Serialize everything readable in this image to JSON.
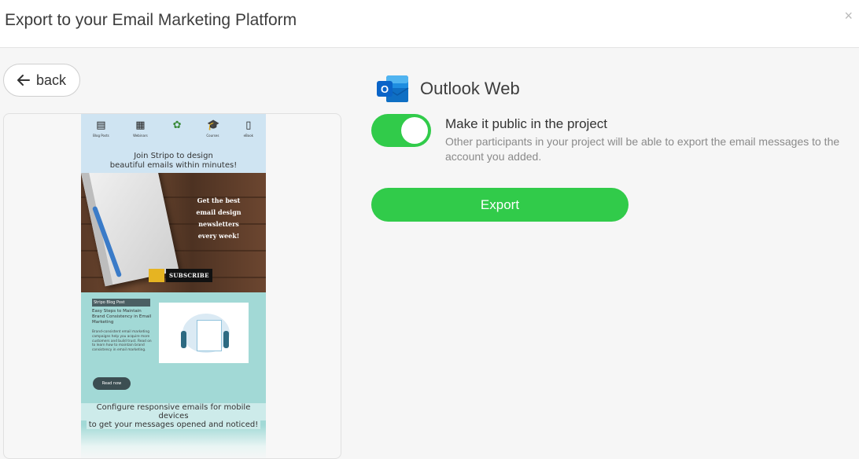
{
  "dialog": {
    "title": "Export to your Email Marketing Platform",
    "close_icon": "×"
  },
  "back_button": {
    "icon": "arrow-left-icon",
    "label": "back"
  },
  "preview": {
    "nav": [
      {
        "icon": "document-icon",
        "glyph": "▤",
        "label": "Blog Posts"
      },
      {
        "icon": "globe-icon",
        "glyph": "▦",
        "label": "Webinars"
      },
      {
        "icon": "plant-icon",
        "glyph": "✿",
        "label": ""
      },
      {
        "icon": "graduation-cap-icon",
        "glyph": "🎓",
        "label": "Courses"
      },
      {
        "icon": "book-icon",
        "glyph": "▯",
        "label": "eBook"
      }
    ],
    "join_line1": "Join Stripo to design",
    "join_line2": "beautiful emails within minutes!",
    "hero_text": [
      "Get the best",
      "email design",
      "newsletters",
      "every week!"
    ],
    "subscribe_label": "SUBSCRIBE",
    "blog_tag": "Stripo Blog Post",
    "blog_title": "Easy Steps to Maintain Brand Consistency in Email Marketing",
    "blog_body": "Brand-consistent email marketing campaigns help you acquire more customers and build trust. Read on to learn how to maintain brand consistency in email marketing.",
    "read_now": "Read now",
    "config_line1": "Configure responsive emails for mobile devices",
    "config_line2": "to get your messages opened and noticed!"
  },
  "service": {
    "name": "Outlook Web",
    "logo_icon": "outlook-icon",
    "logo_letter": "O"
  },
  "public_toggle": {
    "on": true,
    "label": "Make it public in the project",
    "description": "Other participants in your project will be able to export the email messages to the account you added."
  },
  "export_button": {
    "label": "Export"
  },
  "colors": {
    "accent_green": "#31cb4a",
    "outlook_blue": "#0a64c8"
  }
}
